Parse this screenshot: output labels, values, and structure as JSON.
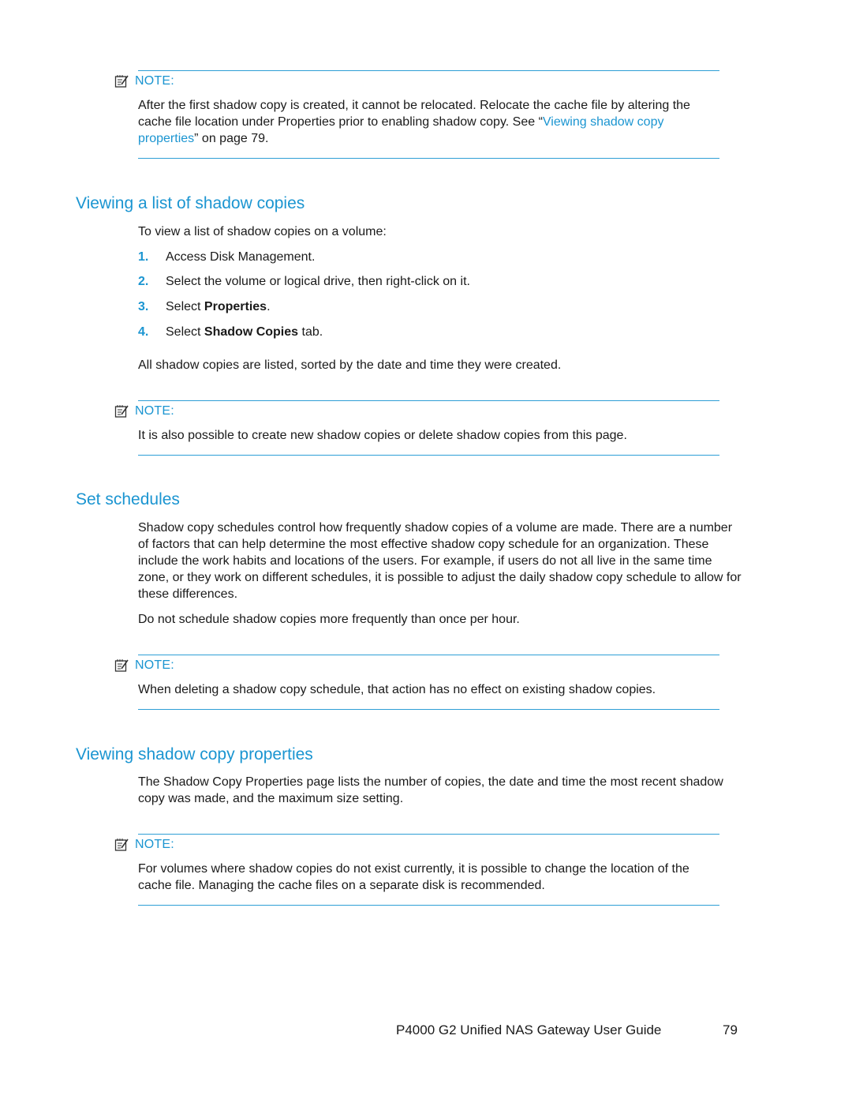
{
  "notes": [
    {
      "label": "NOTE:",
      "text_before": "After the first shadow copy is created, it cannot be relocated. Relocate the cache file by altering the cache file location under Properties prior to enabling shadow copy. See “",
      "link": "Viewing shadow copy properties",
      "text_after": "” on page 79."
    },
    {
      "label": "NOTE:",
      "text": "It is also possible to create new shadow copies or delete shadow copies from this page."
    },
    {
      "label": "NOTE:",
      "text": "When deleting a shadow copy schedule, that action has no effect on existing shadow copies."
    },
    {
      "label": "NOTE:",
      "text": "For volumes where shadow copies do not exist currently, it is possible to change the location of the cache file. Managing the cache files on a separate disk is recommended."
    }
  ],
  "sections": {
    "viewing_list": {
      "heading": "Viewing a list of shadow copies",
      "intro": "To view a list of shadow copies on a volume:",
      "steps": [
        {
          "num": "1.",
          "text": "Access Disk Management."
        },
        {
          "num": "2.",
          "text": "Select the volume or logical drive, then right-click on it."
        },
        {
          "num": "3.",
          "pre": "Select ",
          "bold": "Properties",
          "post": "."
        },
        {
          "num": "4.",
          "pre": "Select ",
          "bold": "Shadow Copies",
          "post": " tab."
        }
      ],
      "outro": "All shadow copies are listed, sorted by the date and time they were created."
    },
    "set_schedules": {
      "heading": "Set schedules",
      "para1": "Shadow copy schedules control how frequently shadow copies of a volume are made. There are a number of factors that can help determine the most effective shadow copy schedule for an organization. These include the work habits and locations of the users. For example, if users do not all live in the same time zone, or they work on different schedules, it is possible to adjust the daily shadow copy schedule to allow for these differences.",
      "para2": "Do not schedule shadow copies more frequently than once per hour."
    },
    "viewing_properties": {
      "heading": "Viewing shadow copy properties",
      "para": "The Shadow Copy Properties page lists the number of copies, the date and time the most recent shadow copy was made, and the maximum size setting."
    }
  },
  "footer": {
    "title": "P4000 G2 Unified NAS Gateway User Guide",
    "page_number": "79"
  },
  "colors": {
    "accent": "#1b95d1",
    "rule": "#2e9fd6",
    "text": "#1a1a1a"
  }
}
